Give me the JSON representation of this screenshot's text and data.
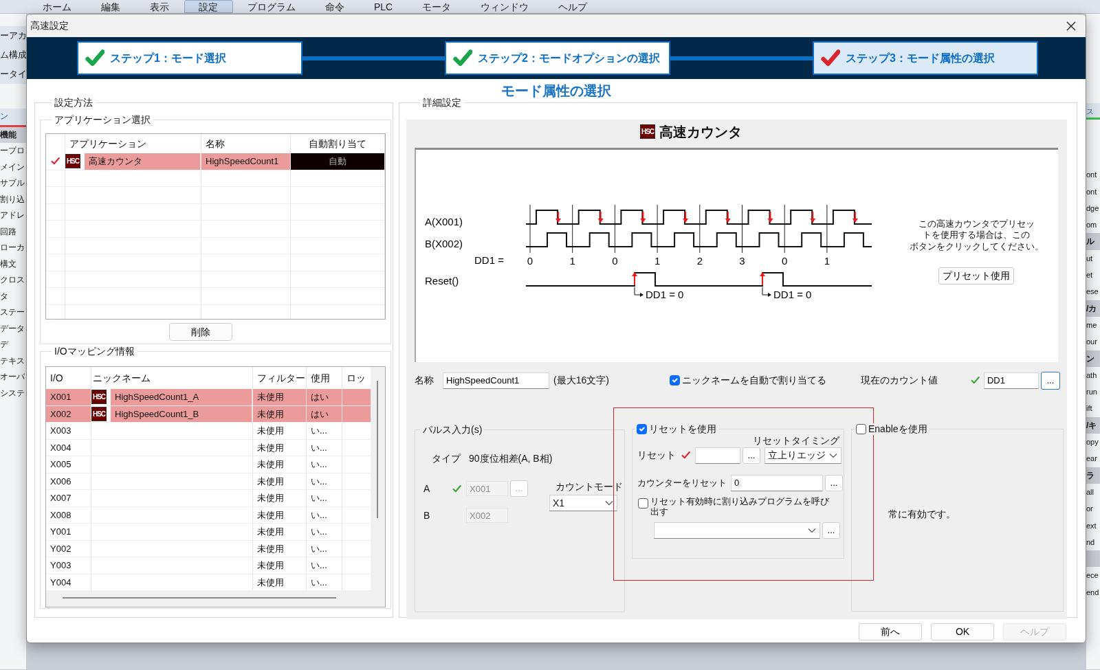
{
  "app": {
    "menu": [
      {
        "label": "ホーム",
        "selected": false
      },
      {
        "label": "編集",
        "selected": false
      },
      {
        "label": "表示",
        "selected": false
      },
      {
        "label": "設定",
        "selected": true
      },
      {
        "label": "プログラム",
        "selected": false
      },
      {
        "label": "命令",
        "selected": false
      },
      {
        "label": "PLC",
        "selected": false
      },
      {
        "label": "モータ",
        "selected": false
      },
      {
        "label": "ウィンドウ",
        "selected": false
      },
      {
        "label": "ヘルプ",
        "selected": false
      }
    ],
    "left_fragments_top": [
      "ーアカ",
      "ム構成",
      "ータイ"
    ],
    "left_fragments": [
      {
        "text": "ン",
        "kind": "tab"
      },
      {
        "text": "機能",
        "kind": "header"
      },
      {
        "text": "ープロ",
        "kind": "item"
      },
      {
        "text": "メイン",
        "kind": "item"
      },
      {
        "text": "サブル",
        "kind": "item"
      },
      {
        "text": "割り込",
        "kind": "item"
      },
      {
        "text": "アドレ",
        "kind": "item"
      },
      {
        "text": "回路",
        "kind": "item"
      },
      {
        "text": "ローカ",
        "kind": "item"
      },
      {
        "text": "構文",
        "kind": "item"
      },
      {
        "text": "クロス",
        "kind": "item"
      },
      {
        "text": "タ",
        "kind": "item"
      },
      {
        "text": "ステー",
        "kind": "item"
      },
      {
        "text": "データ",
        "kind": "item"
      },
      {
        "text": "デ",
        "kind": "item"
      },
      {
        "text": "テキス",
        "kind": "item"
      },
      {
        "text": "オーバ",
        "kind": "item"
      },
      {
        "text": "システ",
        "kind": "item"
      }
    ],
    "right_fragments": [
      {
        "text": "ス",
        "kind": "tab"
      },
      {
        "text": "ont",
        "kind": "item"
      },
      {
        "text": "ont",
        "kind": "item"
      },
      {
        "text": "dge",
        "kind": "item"
      },
      {
        "text": "om",
        "kind": "item"
      },
      {
        "text": "ル",
        "kind": "header"
      },
      {
        "text": "ut",
        "kind": "item"
      },
      {
        "text": "et",
        "kind": "item"
      },
      {
        "text": "ese",
        "kind": "item"
      },
      {
        "text": "/カ",
        "kind": "header"
      },
      {
        "text": "me",
        "kind": "item"
      },
      {
        "text": "our",
        "kind": "item"
      },
      {
        "text": "ン",
        "kind": "header"
      },
      {
        "text": "ath",
        "kind": "item"
      },
      {
        "text": "run",
        "kind": "item"
      },
      {
        "text": "ift",
        "kind": "item"
      },
      {
        "text": "/キ",
        "kind": "header"
      },
      {
        "text": "opy",
        "kind": "item"
      },
      {
        "text": "ear",
        "kind": "item"
      },
      {
        "text": "ラ",
        "kind": "header"
      },
      {
        "text": "all",
        "kind": "item"
      },
      {
        "text": "or",
        "kind": "item"
      },
      {
        "text": "ext",
        "kind": "item"
      },
      {
        "text": "nd",
        "kind": "item"
      },
      {
        "kind": "header"
      },
      {
        "text": "ece",
        "kind": "item"
      },
      {
        "text": "end",
        "kind": "item"
      }
    ]
  },
  "dialog": {
    "title": "高速設定",
    "steps": [
      {
        "label": "ステップ1：モード選択",
        "selected": false
      },
      {
        "label": "ステップ2：モードオプションの選択",
        "selected": false
      },
      {
        "label": "ステップ3：モード属性の選択",
        "selected": true
      }
    ],
    "heading": "モード属性の選択",
    "setting_method": {
      "title": "設定方法",
      "app_select": {
        "title": "アプリケーション選択",
        "columns": [
          "アプリケーション",
          "名称",
          "自動割り当て"
        ],
        "rows": [
          {
            "checked": true,
            "selected": true,
            "badge": "HSC",
            "application": "高速カウンタ",
            "name": "HighSpeedCount1",
            "auto": "自動"
          }
        ]
      },
      "delete_button": "削除",
      "io_mapping": {
        "title": "I/Oマッピング情報",
        "columns": [
          "I/O",
          "ニックネーム",
          "フィルター",
          "使用",
          "ロッ"
        ],
        "rows": [
          {
            "io": "X001",
            "badge": "HSC",
            "nickname": "HighSpeedCount1_A",
            "filter": "未使用",
            "use": "はい",
            "selected": true
          },
          {
            "io": "X002",
            "badge": "HSC",
            "nickname": "HighSpeedCount1_B",
            "filter": "未使用",
            "use": "はい",
            "selected": true
          },
          {
            "io": "X003",
            "filter": "未使用",
            "use": "い...",
            "selected": false
          },
          {
            "io": "X004",
            "filter": "未使用",
            "use": "い...",
            "selected": false
          },
          {
            "io": "X005",
            "filter": "未使用",
            "use": "い...",
            "selected": false
          },
          {
            "io": "X006",
            "filter": "未使用",
            "use": "い...",
            "selected": false
          },
          {
            "io": "X007",
            "filter": "未使用",
            "use": "い...",
            "selected": false
          },
          {
            "io": "X008",
            "filter": "未使用",
            "use": "い...",
            "selected": false
          },
          {
            "io": "Y001",
            "filter": "未使用",
            "use": "い...",
            "selected": false
          },
          {
            "io": "Y002",
            "filter": "未使用",
            "use": "い...",
            "selected": false
          },
          {
            "io": "Y003",
            "filter": "未使用",
            "use": "い...",
            "selected": false
          },
          {
            "io": "Y004",
            "filter": "未使用",
            "use": "い...",
            "selected": false
          }
        ]
      }
    },
    "detail": {
      "title": "詳細設定",
      "badge": "HSC",
      "name": "高速カウンタ",
      "diagram": {
        "labels": [
          "A(X001)",
          "B(X002)",
          "DD1 =",
          "Reset()"
        ],
        "counts": [
          "0",
          "1",
          "0",
          "1",
          "2",
          "3",
          "0",
          "1"
        ],
        "reset_notes": [
          "DD1 = 0",
          "DD1 = 0"
        ]
      },
      "preset_note_lines": [
        "この高速カウンタでプリセッ",
        "トを使用する場合は、この",
        "ボタンをクリックしてください。"
      ],
      "preset_button": "プリセット使用",
      "name_label": "名称",
      "name_value": "HighSpeedCount1",
      "name_hint": "(最大16文字)",
      "auto_nickname": {
        "label": "ニックネームを自動で割り当てる",
        "checked": true
      },
      "count_label": "現在のカウント値",
      "count_valid": true,
      "count_value": "DD1",
      "count_browse": "...",
      "pulse": {
        "title": "パルス入力(s)",
        "type_label": "タイプ",
        "type_value": "90度位相差(A, B相)",
        "inputs": [
          {
            "label": "A",
            "valid": true,
            "value": "X001",
            "disabled": true,
            "browse": "..."
          },
          {
            "label": "B",
            "value": "X002",
            "disabled": true
          }
        ],
        "count_mode_label": "カウントモード",
        "count_mode_value": "X1"
      },
      "reset": {
        "label": "リセットを使用",
        "checked": true,
        "timing_label": "リセットタイミング",
        "reset_label": "リセット",
        "reset_valid": false,
        "reset_browse": "...",
        "timing_value": "立上りエッジ",
        "counter_reset_label": "カウンターをリセット",
        "counter_reset_value": "0",
        "counter_reset_browse": "...",
        "interrupt": {
          "label": "リセット有効時に割り込みプログラムを呼び出す",
          "checked": false
        },
        "interrupt_browse": "..."
      },
      "enable": {
        "label": "Enableを使用",
        "checked": false,
        "note": "常に有効です。"
      }
    },
    "buttons": [
      {
        "label": "前へ",
        "disabled": false
      },
      {
        "label": "OK",
        "disabled": false
      },
      {
        "label": "ヘルプ",
        "disabled": true
      }
    ]
  }
}
